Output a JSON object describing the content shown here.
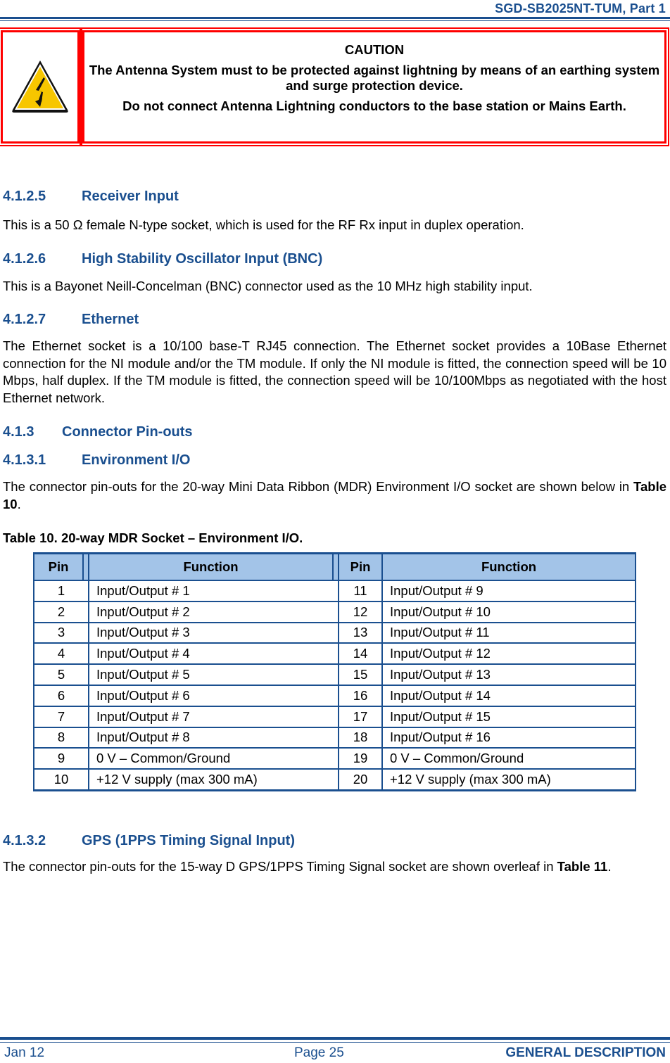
{
  "header": {
    "doc_title": "SGD-SB2025NT-TUM, Part 1"
  },
  "caution": {
    "icon": "lightning-warning-icon",
    "title": "CAUTION",
    "line1": "The Antenna System must to be protected against lightning by means of an earthing system and surge protection device.",
    "line2": "Do not connect Antenna Lightning conductors to the base station or Mains Earth."
  },
  "sections": {
    "receiver_input": {
      "number": "4.1.2.5",
      "title": "Receiver Input",
      "body": "This is a 50 Ω female N-type socket, which is used for the RF Rx input in duplex operation."
    },
    "oscillator_input": {
      "number": "4.1.2.6",
      "title": "High Stability Oscillator Input (BNC)",
      "body": "This is a Bayonet Neill-Concelman (BNC) connector used as the 10 MHz high stability input."
    },
    "ethernet": {
      "number": "4.1.2.7",
      "title": "Ethernet",
      "body": "The Ethernet socket is a 10/100 base-T RJ45 connection.  The Ethernet socket provides a 10Base Ethernet connection for the NI module and/or the TM module.  If only the NI module is fitted, the connection speed will be 10 Mbps, half duplex.  If the TM module is fitted, the connection speed will be 10/100Mbps as negotiated with the host Ethernet network."
    },
    "connector_pinouts": {
      "number": "4.1.3",
      "title": "Connector Pin-outs"
    },
    "environment_io": {
      "number": "4.1.3.1",
      "title": "Environment I/O",
      "body_prefix": "The connector pin-outs for the 20-way Mini Data Ribbon (MDR) Environment I/O socket are shown below in ",
      "body_ref": "Table 10",
      "body_suffix": "."
    },
    "gps": {
      "number": "4.1.3.2",
      "title": "GPS (1PPS Timing Signal Input)",
      "body_prefix": "The connector pin-outs for the 15-way D GPS/1PPS Timing Signal socket are shown overleaf in ",
      "body_ref": "Table 11",
      "body_suffix": "."
    }
  },
  "table10": {
    "caption": "Table 10.  20-way MDR Socket – Environment I/O.",
    "headers": [
      "Pin",
      "Function",
      "Pin",
      "Function"
    ],
    "rows": [
      {
        "pin_a": "1",
        "fn_a": "Input/Output # 1",
        "pin_b": "11",
        "fn_b": "Input/Output # 9"
      },
      {
        "pin_a": "2",
        "fn_a": "Input/Output # 2",
        "pin_b": "12",
        "fn_b": "Input/Output # 10"
      },
      {
        "pin_a": "3",
        "fn_a": "Input/Output # 3",
        "pin_b": "13",
        "fn_b": "Input/Output # 11"
      },
      {
        "pin_a": "4",
        "fn_a": "Input/Output # 4",
        "pin_b": "14",
        "fn_b": "Input/Output # 12"
      },
      {
        "pin_a": "5",
        "fn_a": "Input/Output # 5",
        "pin_b": "15",
        "fn_b": "Input/Output # 13"
      },
      {
        "pin_a": "6",
        "fn_a": "Input/Output # 6",
        "pin_b": "16",
        "fn_b": "Input/Output # 14"
      },
      {
        "pin_a": "7",
        "fn_a": "Input/Output # 7",
        "pin_b": "17",
        "fn_b": "Input/Output # 15"
      },
      {
        "pin_a": "8",
        "fn_a": "Input/Output # 8",
        "pin_b": "18",
        "fn_b": "Input/Output # 16"
      },
      {
        "pin_a": "9",
        "fn_a": "0 V – Common/Ground",
        "pin_b": "19",
        "fn_b": "0 V – Common/Ground"
      },
      {
        "pin_a": "10",
        "fn_a": "+12 V supply (max 300 mA)",
        "pin_b": "20",
        "fn_b": "+12 V supply (max 300 mA)"
      }
    ]
  },
  "footer": {
    "date": "Jan 12",
    "page": "Page 25",
    "chapter": "GENERAL DESCRIPTION"
  },
  "colors": {
    "heading_blue": "#1a4f8f",
    "caution_red": "#ff0000",
    "table_header_bg": "#a3c4e8",
    "warning_yellow": "#f7c600"
  }
}
